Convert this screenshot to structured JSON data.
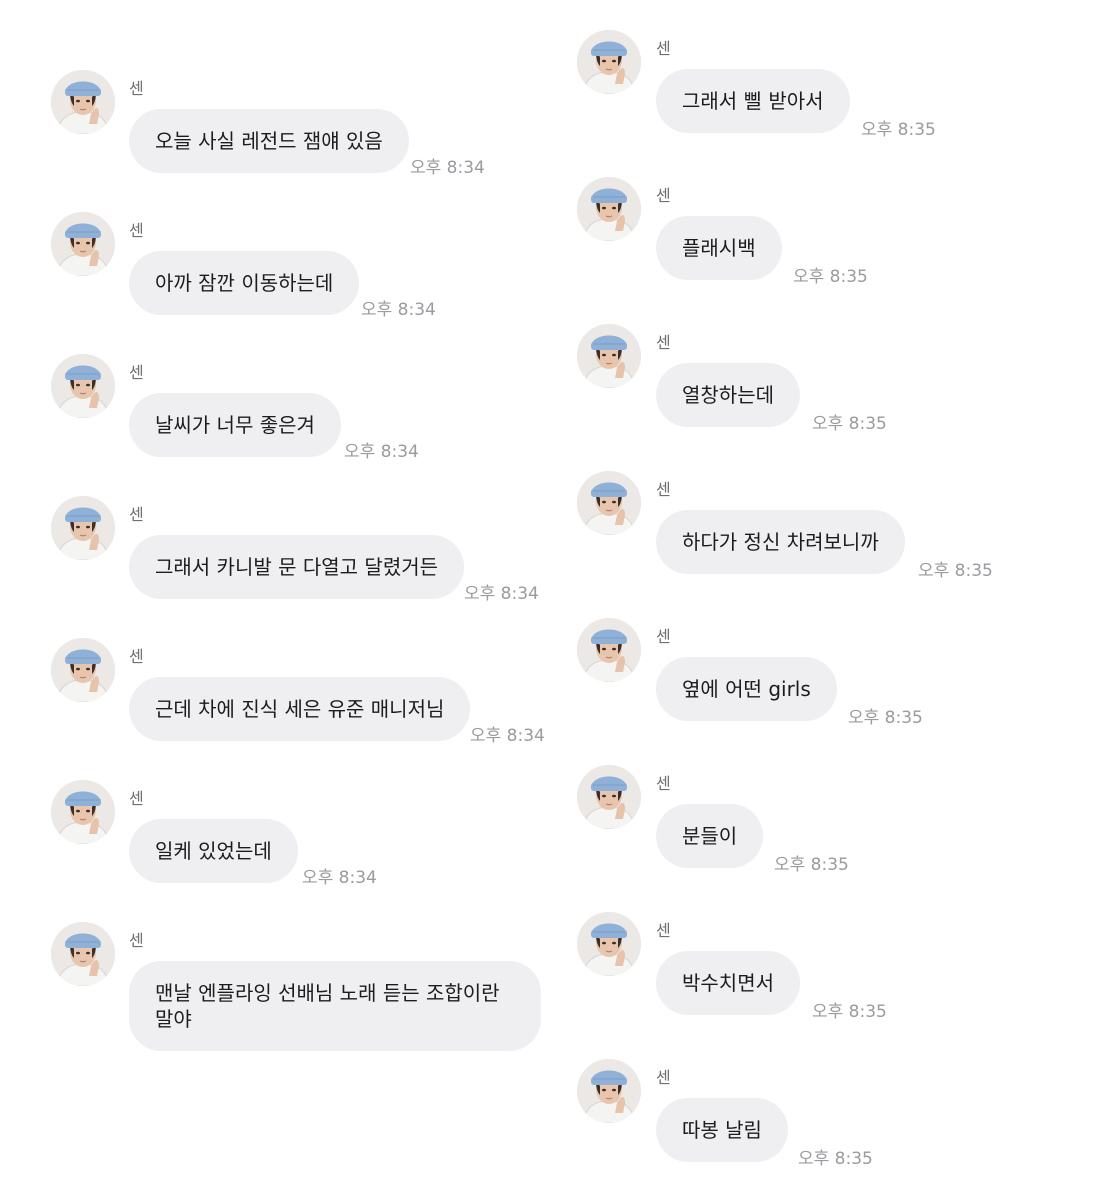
{
  "chat": {
    "sender_name": "센",
    "avatar_icon": "profile-photo-avatar",
    "colors": {
      "bubble": "#efeff2",
      "text": "#1c1c1c",
      "time": "#9a9aa0",
      "name": "#6f6f6f",
      "hat": "#8fb1d8"
    },
    "left_messages": [
      {
        "text": "오늘 사실 레전드 잼얘 있음",
        "time": "오후 8:34"
      },
      {
        "text": "아까 잠깐 이동하는데",
        "time": "오후 8:34"
      },
      {
        "text": "날씨가 너무 좋은겨",
        "time": "오후 8:34"
      },
      {
        "text": "그래서 카니발 문 다열고 달렸거든",
        "time": "오후 8:34"
      },
      {
        "text": "근데 차에 진식 세은 유준 매니저님",
        "time": "오후 8:34"
      },
      {
        "text": "일케 있었는데",
        "time": "오후 8:34"
      },
      {
        "text": "맨날 엔플라잉 선배님 노래 듣는 조합이란 말야",
        "time": ""
      }
    ],
    "right_messages": [
      {
        "text": "그래서 삘 받아서",
        "time": "오후 8:35"
      },
      {
        "text": "플래시백",
        "time": "오후 8:35"
      },
      {
        "text": "열창하는데",
        "time": "오후 8:35"
      },
      {
        "text": "하다가 정신 차려보니까",
        "time": "오후 8:35"
      },
      {
        "text": "옆에 어떤 girls",
        "time": "오후 8:35"
      },
      {
        "text": "분들이",
        "time": "오후 8:35"
      },
      {
        "text": "박수치면서",
        "time": "오후 8:35"
      },
      {
        "text": "따봉 날림",
        "time": "오후 8:35"
      }
    ]
  }
}
